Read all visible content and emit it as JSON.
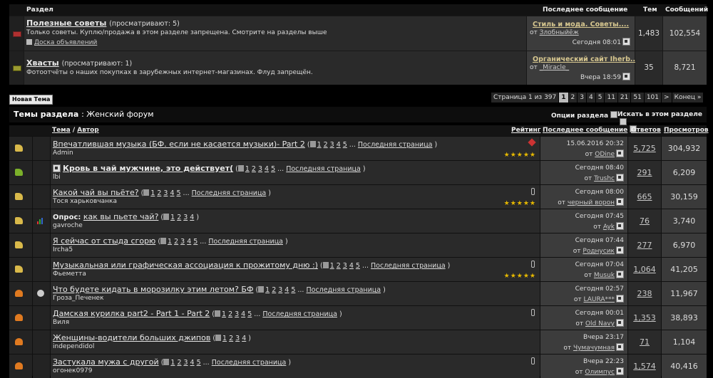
{
  "forums": {
    "headers": {
      "section": "Раздел",
      "last": "Последнее сообщение",
      "topics": "Тем",
      "posts": "Сообщений"
    },
    "rows": [
      {
        "title": "Полезные советы",
        "viewing": "(просматривают: 5)",
        "desc": "Только советы. Куплю/продажа в этом разделе запрещена. Смотрите на разделы выше",
        "sublink": "Доска объявлений",
        "last_title": "Стиль и мода. Советы....",
        "last_prefix": "от",
        "last_user": "Злобныйёж",
        "last_time": "Сегодня 08:01",
        "topics": "1,483",
        "posts": "102,554"
      },
      {
        "title": "Хвасты",
        "viewing": "(просматривают: 1)",
        "desc": "Фотоотчёты о наших покупках в зарубежных интернет-магазинах. Флуд запрещён.",
        "last_title": "Органический сайт Iherb...",
        "last_prefix": "от",
        "last_user": "_Miracle_",
        "last_time": "Вчера 18:59",
        "topics": "35",
        "posts": "8,721"
      }
    ]
  },
  "toolbar": {
    "new_topic": "Новая Тема",
    "pager": {
      "label": "Страница 1 из 397",
      "pages": [
        "1",
        "2",
        "3",
        "4",
        "5",
        "11",
        "21",
        "51",
        "101",
        ">",
        "Конец »"
      ]
    }
  },
  "section": {
    "title": "Темы раздела",
    "name": ": Женский форум",
    "options": "Опции раздела",
    "search": "Искать в этом разделе"
  },
  "topics": {
    "headers": {
      "topic": "Тема",
      "sep": " / ",
      "author": "Автор",
      "rating": "Рейтинг",
      "last": "Последнее сообщение",
      "replies": "Ответов",
      "views": "Просмотров"
    },
    "last_page_label": "Последняя страница",
    "rows": [
      {
        "prefix": "",
        "title": "Впечатлившая музыка (БФ. если не касается музыки)- Part 2",
        "pages": [
          "1",
          "2",
          "3",
          "4",
          "5"
        ],
        "more": "...",
        "lastp": true,
        "author": "Admin",
        "stars": "★★★★★",
        "flag": "pin",
        "icon": "thumb",
        "pi": "",
        "date": "15.06.2016 20:32",
        "by": "от",
        "user": "ODine",
        "replies": "5,725",
        "views": "304,932",
        "bold": false
      },
      {
        "prefix": "",
        "title": "Кровь в чай мужчине, это действует(",
        "pages": [
          "1",
          "2",
          "3",
          "4",
          "5"
        ],
        "more": "...",
        "lastp": true,
        "author": "lbi",
        "stars": "",
        "flag": "",
        "icon": "green",
        "pi": "",
        "date": "Сегодня 08:40",
        "by": "от",
        "user": "Trushc",
        "replies": "291",
        "views": "6,209",
        "bold": true
      },
      {
        "prefix": "",
        "title": "Какой чай вы пьёте?",
        "pages": [
          "1",
          "2",
          "3",
          "4",
          "5"
        ],
        "more": "...",
        "lastp": true,
        "author": "Тося харьковчанка",
        "stars": "★★★★★",
        "flag": "clip",
        "icon": "thumb",
        "pi": "",
        "date": "Сегодня 08:00",
        "by": "от",
        "user": "черный ворон",
        "replies": "665",
        "views": "30,159",
        "bold": false
      },
      {
        "prefix": "Опрос:",
        "title": "как вы пьете чай?",
        "pages": [
          "1",
          "2",
          "3",
          "4"
        ],
        "more": "",
        "lastp": false,
        "author": "gavroche",
        "stars": "",
        "flag": "",
        "icon": "thumb",
        "pi": "poll",
        "date": "Сегодня 07:45",
        "by": "от",
        "user": "Ayk",
        "replies": "76",
        "views": "3,740",
        "bold": false
      },
      {
        "prefix": "",
        "title": "Я сейчас от стыда сгорю",
        "pages": [
          "1",
          "2",
          "3",
          "4",
          "5"
        ],
        "more": "...",
        "lastp": true,
        "author": "Ircha5",
        "stars": "",
        "flag": "",
        "icon": "thumb",
        "pi": "",
        "date": "Сегодня 07:44",
        "by": "от",
        "user": "Роднусик",
        "replies": "277",
        "views": "6,970",
        "bold": false
      },
      {
        "prefix": "",
        "title": "Музыкальная или графическая ассоциация к прожитому дню :)",
        "pages": [
          "1",
          "2",
          "3",
          "4",
          "5"
        ],
        "more": "...",
        "lastp": true,
        "author": "Фьеметта",
        "stars": "★★★★★",
        "flag": "clip",
        "icon": "thumb",
        "pi": "",
        "date": "Сегодня 07:04",
        "by": "от",
        "user": "Musuk",
        "replies": "1,064",
        "views": "41,205",
        "bold": false
      },
      {
        "prefix": "",
        "title": "Что будете кидать в морозилку этим летом? БФ",
        "pages": [
          "1",
          "2",
          "3",
          "4",
          "5"
        ],
        "more": "...",
        "lastp": true,
        "author": "Гроза_Печенек",
        "stars": "",
        "flag": "",
        "icon": "fire",
        "pi": "smile",
        "date": "Сегодня 02:57",
        "by": "от",
        "user": "LAURA***",
        "replies": "238",
        "views": "11,967",
        "bold": false
      },
      {
        "prefix": "",
        "title": "Дамская курилка part2 - Part 1 - Part 2",
        "pages": [
          "1",
          "2",
          "3",
          "4",
          "5"
        ],
        "more": "...",
        "lastp": true,
        "author": "Виля",
        "stars": "",
        "flag": "clip",
        "icon": "fire",
        "pi": "",
        "date": "Сегодня 00:01",
        "by": "от",
        "user": "Old Navy",
        "replies": "1,353",
        "views": "38,893",
        "bold": false
      },
      {
        "prefix": "",
        "title": "Женщины-водители больших джипов",
        "pages": [
          "1",
          "2",
          "3",
          "4"
        ],
        "more": "",
        "lastp": false,
        "author": "independidol",
        "stars": "",
        "flag": "",
        "icon": "fire",
        "pi": "",
        "date": "Вчера 23:17",
        "by": "от",
        "user": "Чумачумная",
        "replies": "71",
        "views": "1,104",
        "bold": false
      },
      {
        "prefix": "",
        "title": "Застукала мужа с другой",
        "pages": [
          "1",
          "2",
          "3",
          "4",
          "5"
        ],
        "more": "...",
        "lastp": true,
        "author": "огонек0979",
        "stars": "",
        "flag": "clip",
        "icon": "fire",
        "pi": "",
        "date": "Вчера 22:23",
        "by": "от",
        "user": "Олимпус",
        "replies": "1,574",
        "views": "40,416",
        "bold": false
      }
    ]
  }
}
